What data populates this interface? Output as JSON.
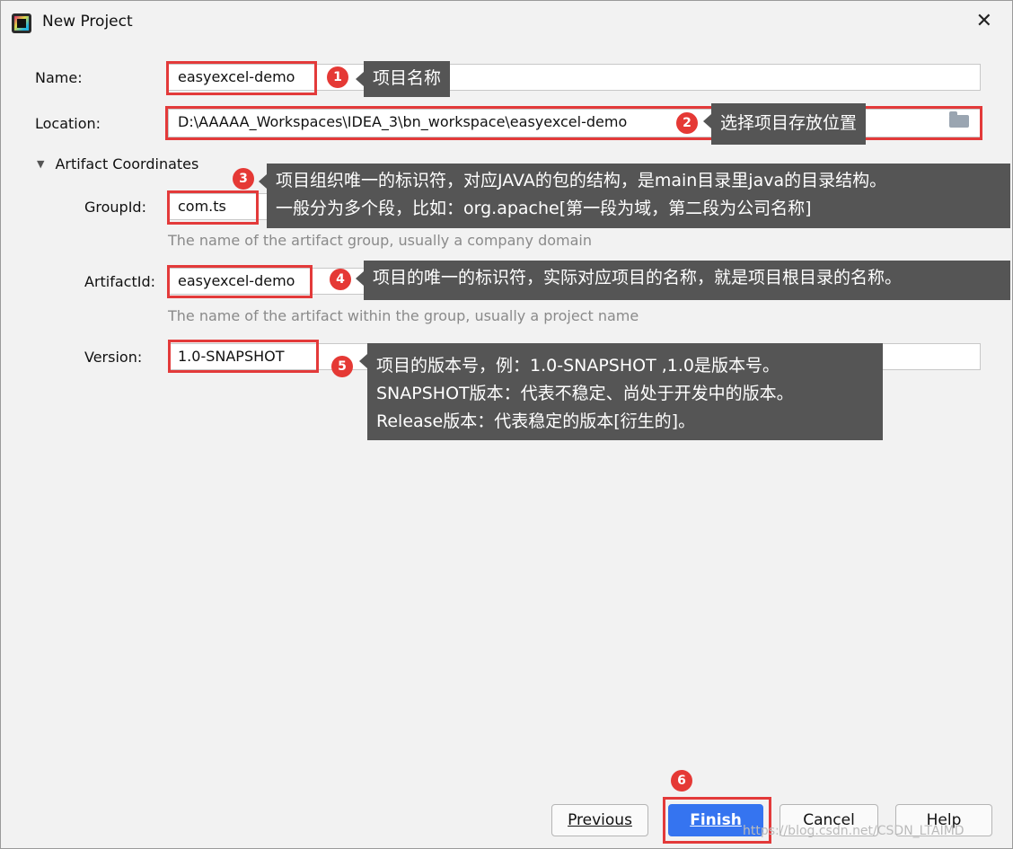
{
  "window": {
    "title": "New Project",
    "close_glyph": "✕"
  },
  "form": {
    "name_label": "Name:",
    "name_value": "easyexcel-demo",
    "location_label": "Location:",
    "location_value": "D:\\AAAAA_Workspaces\\IDEA_3\\bn_workspace\\easyexcel-demo",
    "section_label": "Artifact Coordinates",
    "groupid_label": "GroupId:",
    "groupid_value": "com.ts",
    "groupid_hint": "The name of the artifact group, usually a company domain",
    "artifactid_label": "ArtifactId:",
    "artifactid_value": "easyexcel-demo",
    "artifactid_hint": "The name of the artifact within the group, usually a project name",
    "version_label": "Version:",
    "version_value": "1.0-SNAPSHOT"
  },
  "annotations": [
    {
      "num": "1",
      "lines": [
        "项目名称"
      ]
    },
    {
      "num": "2",
      "lines": [
        "选择项目存放位置"
      ]
    },
    {
      "num": "3",
      "lines": [
        "项目组织唯一的标识符，对应JAVA的包的结构，是main目录里java的目录结构。",
        "一般分为多个段，比如：org.apache[第一段为域，第二段为公司名称]"
      ]
    },
    {
      "num": "4",
      "lines": [
        "项目的唯一的标识符，实际对应项目的名称，就是项目根目录的名称。"
      ]
    },
    {
      "num": "5",
      "lines": [
        "项目的版本号，例：1.0-SNAPSHOT ,1.0是版本号。",
        "SNAPSHOT版本：代表不稳定、尚处于开发中的版本。",
        "Release版本：代表稳定的版本[衍生的]。"
      ]
    },
    {
      "num": "6",
      "lines": []
    }
  ],
  "buttons": {
    "previous": "Previous",
    "finish": "Finish",
    "cancel": "Cancel",
    "help": "Help"
  },
  "watermark": "https://blog.csdn.net/CSDN_LTAIMD",
  "colors": {
    "highlight": "#e33a3a",
    "badge": "#e53935",
    "tooltip": "#555555",
    "primary": "#3574f0"
  },
  "icons": {
    "folder": "folder-icon",
    "app": "intellij-app-icon",
    "close": "close-icon",
    "collapse": "triangle-down-icon"
  }
}
